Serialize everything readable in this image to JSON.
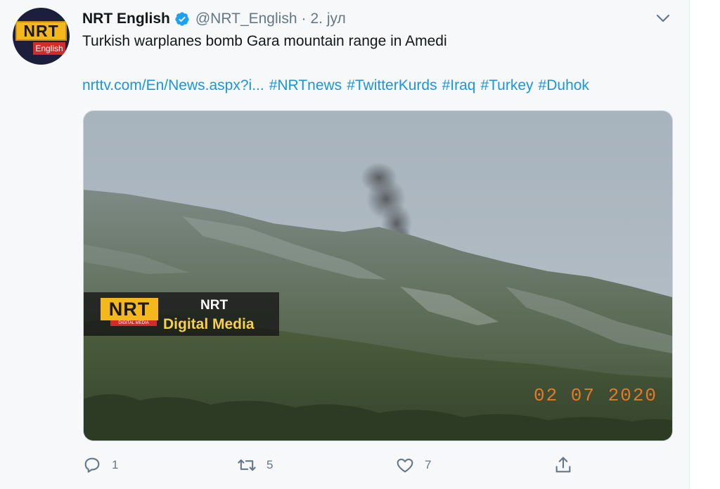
{
  "tweet": {
    "avatar": {
      "logo_text": "NRT",
      "logo_sub": "English"
    },
    "display_name": "NRT English",
    "handle": "@NRT_English",
    "separator": "·",
    "date": "2. јул",
    "text": "Turkish warplanes bomb Gara mountain range in Amedi",
    "link": "nrttv.com/En/News.aspx?i...",
    "hashtags": [
      "#NRTnews",
      "#TwitterKurds",
      "#Iraq",
      "#Turkey",
      "#Duhok"
    ],
    "media": {
      "watermark_logo": "NRT",
      "watermark_logo_sub": "DIGITAL MEDIA",
      "watermark_title": "NRT",
      "watermark_subtitle": "Digital Media",
      "date_stamp": "02 07 2020"
    },
    "actions": {
      "replies": "1",
      "retweets": "5",
      "likes": "7"
    }
  },
  "colors": {
    "link": "#1b95e0",
    "secondary_text": "#657786",
    "verified": "#1da1f2",
    "brand_yellow": "#f4b81c",
    "brand_red": "#d32a2a"
  },
  "icons": [
    "verified-badge-icon",
    "chevron-down-icon",
    "reply-icon",
    "retweet-icon",
    "like-icon",
    "share-icon"
  ]
}
